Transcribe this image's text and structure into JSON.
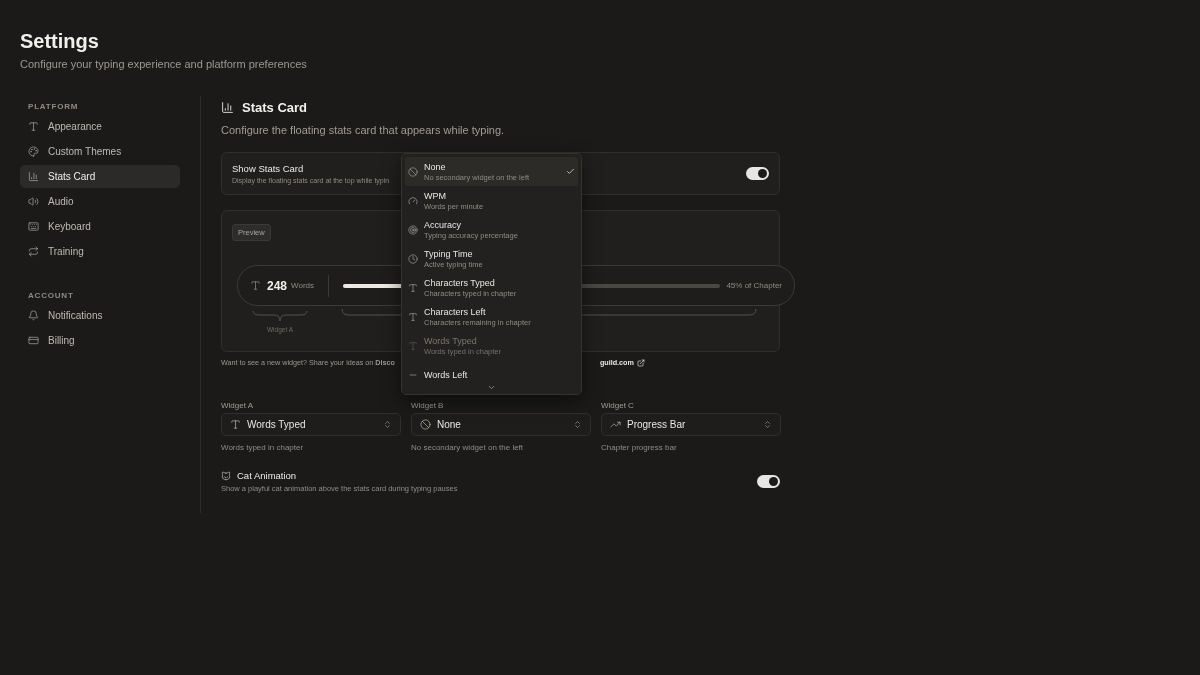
{
  "header": {
    "title": "Settings",
    "subtitle": "Configure your typing experience and platform preferences"
  },
  "sidebar": {
    "sections": [
      {
        "label": "PLATFORM",
        "items": [
          {
            "label": "Appearance",
            "kind": "type",
            "selected": false
          },
          {
            "label": "Custom Themes",
            "kind": "palette",
            "selected": false
          },
          {
            "label": "Stats Card",
            "kind": "chart",
            "selected": true
          },
          {
            "label": "Audio",
            "kind": "audio",
            "selected": false
          },
          {
            "label": "Keyboard",
            "kind": "keyboard",
            "selected": false
          },
          {
            "label": "Training",
            "kind": "repeat",
            "selected": false
          }
        ]
      },
      {
        "label": "ACCOUNT",
        "items": [
          {
            "label": "Notifications",
            "kind": "bell",
            "selected": false
          },
          {
            "label": "Billing",
            "kind": "card",
            "selected": false
          }
        ]
      }
    ]
  },
  "main": {
    "title": "Stats Card",
    "description": "Configure the floating stats card that appears while typing.",
    "show_stats": {
      "label": "Show Stats Card",
      "description": "Display the floating stats card at the top while typin",
      "on": true
    },
    "preview": {
      "badge": "Preview",
      "count": "248",
      "unit": "Words",
      "level": 0.45,
      "progress_label": "45% of Chapter",
      "brace_label": "Widget A"
    },
    "footer_note": "Want to see a new widget? Share your ideas on **Disco**",
    "footer_link": "guild.com",
    "widgets": [
      {
        "label": "Widget A",
        "value": "Words Typed",
        "kind": "type",
        "hint": "Words typed in chapter"
      },
      {
        "label": "Widget B",
        "value": "None",
        "kind": "none",
        "hint": "No secondary widget on the left"
      },
      {
        "label": "Widget C",
        "value": "Progress Bar",
        "kind": "trend",
        "hint": "Chapter progress bar"
      }
    ],
    "cat_animation": {
      "label": "Cat Animation",
      "description": "Show a playful cat animation above the stats card during typing pauses",
      "on": true
    }
  },
  "dropdown": {
    "items": [
      {
        "title": "None",
        "description": "No secondary widget on the left",
        "kind": "none",
        "selected": true,
        "disabled": false
      },
      {
        "title": "WPM",
        "description": "Words per minute",
        "kind": "gauge",
        "selected": false,
        "disabled": false
      },
      {
        "title": "Accuracy",
        "description": "Typing accuracy percentage",
        "kind": "target",
        "selected": false,
        "disabled": false
      },
      {
        "title": "Typing Time",
        "description": "Active typing time",
        "kind": "clock",
        "selected": false,
        "disabled": false
      },
      {
        "title": "Characters Typed",
        "description": "Characters typed in chapter",
        "kind": "type",
        "selected": false,
        "disabled": false
      },
      {
        "title": "Characters Left",
        "description": "Characters remaining in chapter",
        "kind": "type",
        "selected": false,
        "disabled": false
      },
      {
        "title": "Words Typed",
        "description": "Words typed in chapter",
        "kind": "type",
        "selected": false,
        "disabled": true
      },
      {
        "title": "Words Left",
        "kind": "minus",
        "selected": false,
        "disabled": false
      }
    ]
  }
}
